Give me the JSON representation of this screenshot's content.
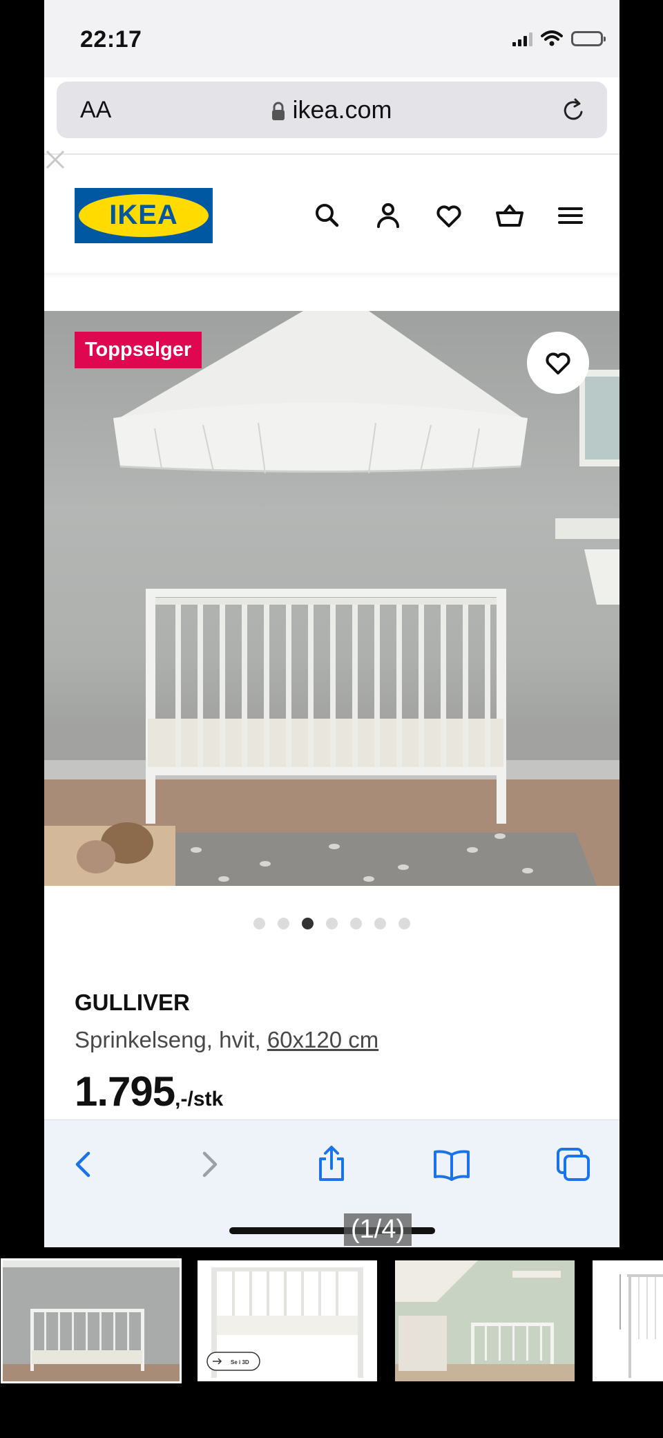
{
  "status_bar": {
    "time": "22:17"
  },
  "browser": {
    "aa_label": "AA",
    "url": "ikea.com"
  },
  "ikea_header": {
    "logo_text": "IKEA"
  },
  "product": {
    "badge": "Toppselger",
    "name": "GULLIVER",
    "description": "Sprinkelseng, hvit,",
    "size": "60x120 cm",
    "price": "1.795",
    "price_suffix": ",-/stk",
    "image_dots": {
      "count": 7,
      "active": 3
    }
  },
  "viewer": {
    "page_counter": "(1/4)"
  },
  "thumbnails": {
    "count": 4,
    "selected": 1,
    "view_3d_label": "Se i 3D"
  },
  "colors": {
    "ikea_blue": "#0058a3",
    "ikea_yellow": "#ffdb00",
    "badge_pink": "#e00751",
    "safari_blue": "#1a73e8"
  },
  "icons": {
    "header": [
      "search-icon",
      "user-icon",
      "heart-icon",
      "basket-icon",
      "menu-icon"
    ],
    "toolbar": [
      "back-icon",
      "forward-icon",
      "share-icon",
      "bookmarks-icon",
      "tabs-icon"
    ]
  }
}
